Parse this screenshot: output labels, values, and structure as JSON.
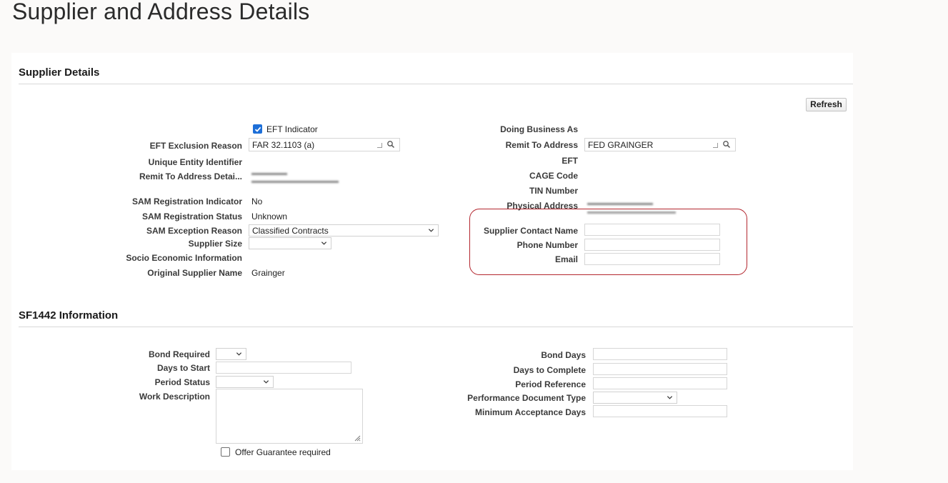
{
  "page_title": "Supplier and Address Details",
  "supplier": {
    "section_title": "Supplier Details",
    "refresh_label": "Refresh",
    "eft_indicator_label": "EFT Indicator",
    "eft_indicator_checked": true,
    "left": {
      "eft_exclusion_label": "EFT Exclusion Reason",
      "eft_exclusion_value": "FAR 32.1103 (a)",
      "uei_label": "Unique Entity Identifier",
      "remit_detail_label": "Remit To Address Detai...",
      "sam_reg_ind_label": "SAM Registration Indicator",
      "sam_reg_ind_value": "No",
      "sam_reg_status_label": "SAM Registration Status",
      "sam_reg_status_value": "Unknown",
      "sam_exception_label": "SAM Exception Reason",
      "sam_exception_value": "Classified Contracts",
      "supplier_size_label": "Supplier Size",
      "supplier_size_value": "",
      "socio_label": "Socio Economic Information",
      "orig_supplier_label": "Original Supplier Name",
      "orig_supplier_value": "Grainger"
    },
    "right": {
      "dba_label": "Doing Business As",
      "remit_to_label": "Remit To Address",
      "remit_to_value": "FED GRAINGER",
      "eft_label": "EFT",
      "cage_label": "CAGE Code",
      "tin_label": "TIN Number",
      "physical_label": "Physical Address",
      "contact_name_label": "Supplier Contact Name",
      "contact_name_value": "",
      "phone_label": "Phone Number",
      "phone_value": "",
      "email_label": "Email",
      "email_value": ""
    }
  },
  "sf1442": {
    "section_title": "SF1442 Information",
    "left": {
      "bond_required_label": "Bond Required",
      "bond_required_value": "",
      "days_to_start_label": "Days to Start",
      "days_to_start_value": "",
      "period_status_label": "Period Status",
      "period_status_value": "",
      "work_desc_label": "Work Description",
      "work_desc_value": "",
      "offer_guarantee_label": "Offer Guarantee required",
      "offer_guarantee_checked": false
    },
    "right": {
      "bond_days_label": "Bond Days",
      "days_complete_label": "Days to Complete",
      "period_ref_label": "Period Reference",
      "perf_doc_label": "Performance Document Type",
      "perf_doc_value": "",
      "min_accept_label": "Minimum Acceptance Days"
    }
  },
  "colors": {
    "accent_checkbox": "#1d6fd8",
    "highlight_border": "#b3262e"
  }
}
